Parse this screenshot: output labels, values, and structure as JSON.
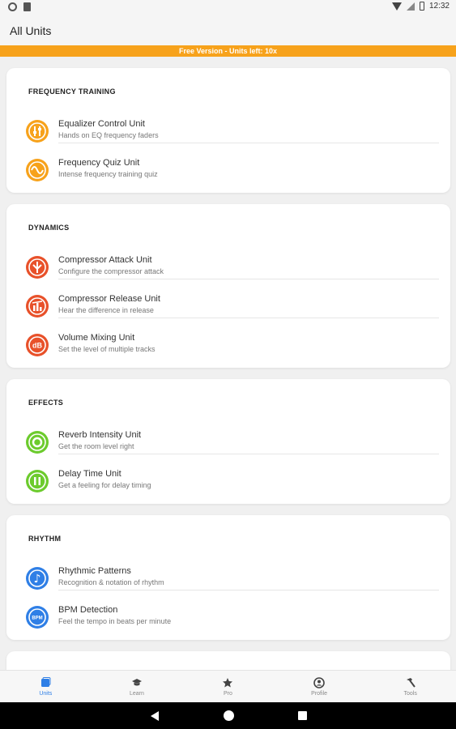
{
  "status_bar": {
    "time": "12:32"
  },
  "app_bar": {
    "title": "All Units"
  },
  "banner": {
    "text": "Free Version - Units left: 10x",
    "color": "#f7a21b"
  },
  "sections": [
    {
      "title": "FREQUENCY TRAINING",
      "items": [
        {
          "title": "Equalizer Control Unit",
          "subtitle": "Hands on EQ frequency faders",
          "icon": "equalizer-faders-icon",
          "color": "#f7a21b"
        },
        {
          "title": "Frequency Quiz Unit",
          "subtitle": "Intense frequency training quiz",
          "icon": "sine-wave-icon",
          "color": "#f7a21b"
        }
      ]
    },
    {
      "title": "DYNAMICS",
      "items": [
        {
          "title": "Compressor Attack Unit",
          "subtitle": "Configure the compressor attack",
          "icon": "compressor-attack-icon",
          "color": "#e8512a"
        },
        {
          "title": "Compressor Release Unit",
          "subtitle": "Hear the difference in release",
          "icon": "compressor-release-icon",
          "color": "#e8512a"
        },
        {
          "title": "Volume Mixing Unit",
          "subtitle": "Set the level of multiple tracks",
          "icon": "db-icon",
          "icon_text": "dB",
          "color": "#e8512a"
        }
      ]
    },
    {
      "title": "EFFECTS",
      "items": [
        {
          "title": "Reverb Intensity Unit",
          "subtitle": "Get the room level right",
          "icon": "reverb-ring-icon",
          "color": "#6ccb2d"
        },
        {
          "title": "Delay Time Unit",
          "subtitle": "Get a feeling for delay timing",
          "icon": "delay-bars-icon",
          "color": "#6ccb2d"
        }
      ]
    },
    {
      "title": "RHYTHM",
      "items": [
        {
          "title": "Rhythmic Patterns",
          "subtitle": "Recognition & notation of rhythm",
          "icon": "music-note-icon",
          "icon_text": "♪",
          "color": "#2f7fe6"
        },
        {
          "title": "BPM Detection",
          "subtitle": "Feel the tempo in beats per minute",
          "icon": "bpm-icon",
          "icon_text": "BPM",
          "color": "#2f7fe6"
        }
      ]
    }
  ],
  "bottom_nav": [
    {
      "label": "Units",
      "icon": "units-icon",
      "active": true
    },
    {
      "label": "Learn",
      "icon": "graduation-cap-icon",
      "active": false
    },
    {
      "label": "Pro",
      "icon": "star-icon",
      "active": false
    },
    {
      "label": "Profile",
      "icon": "profile-icon",
      "active": false
    },
    {
      "label": "Tools",
      "icon": "hammer-icon",
      "active": false
    }
  ]
}
